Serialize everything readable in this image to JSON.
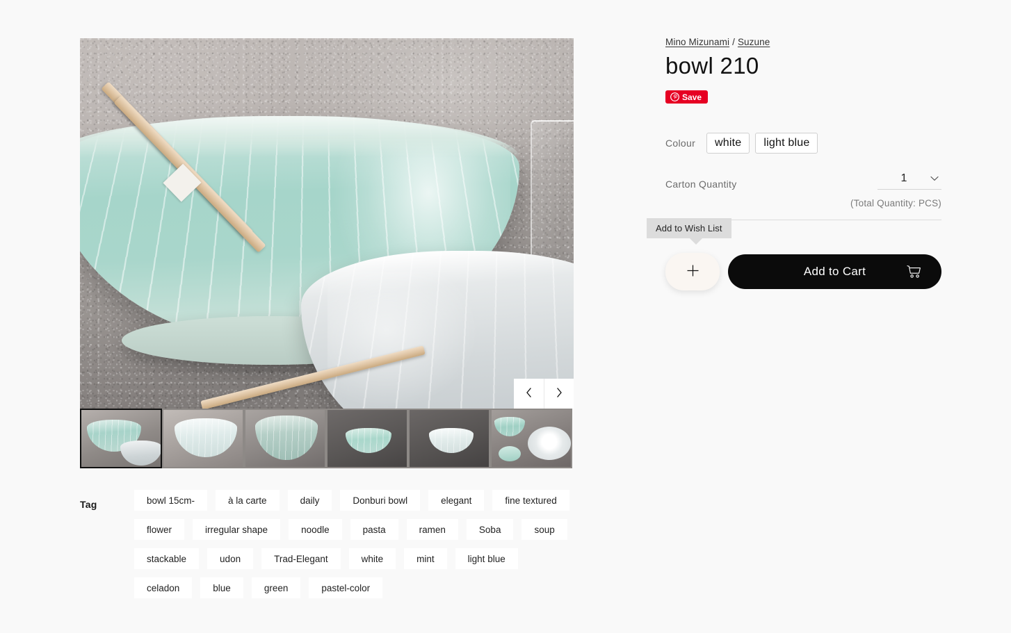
{
  "product": {
    "breadcrumb": {
      "brand": "Mino Mizunami",
      "separator": "/",
      "series": "Suzune"
    },
    "title": "bowl 210",
    "pin_save_label": "Save"
  },
  "options": {
    "colour_label": "Colour",
    "colours": [
      {
        "label": "white"
      },
      {
        "label": "light blue"
      }
    ],
    "carton_quantity_label": "Carton Quantity",
    "carton_quantity_value": "1",
    "carton_quantity_options": [
      "1"
    ],
    "total_quantity_note": "(Total Quantity: PCS)"
  },
  "actions": {
    "wishlist_tooltip": "Add to Wish List",
    "wishlist_icon": "plus-icon",
    "add_to_cart_label": "Add to Cart",
    "cart_icon": "shopping-cart-icon"
  },
  "gallery": {
    "prev_icon": "chevron-left-icon",
    "next_icon": "chevron-right-icon",
    "thumbnails": [
      {
        "alt": "celadon fluted bowl with chopsticks",
        "selected": true
      },
      {
        "alt": "white fluted bowl angled view",
        "selected": false
      },
      {
        "alt": "celadon bowl side view",
        "selected": false
      },
      {
        "alt": "celadon bowl on dark background",
        "selected": false
      },
      {
        "alt": "white bowl on dark background",
        "selected": false
      },
      {
        "alt": "bowls and plates set",
        "selected": false
      }
    ]
  },
  "tags": {
    "label": "Tag",
    "items": [
      "bowl 15cm-",
      "à la carte",
      "daily",
      "Donburi bowl",
      "elegant",
      "fine textured",
      "flower",
      "irregular shape",
      "noodle",
      "pasta",
      "ramen",
      "Soba",
      "soup",
      "stackable",
      "udon",
      "Trad-Elegant",
      "white",
      "mint",
      "light blue",
      "celadon",
      "blue",
      "green",
      "pastel-color"
    ]
  },
  "colors": {
    "page_background": "#f9f9f9",
    "accent_pinterest": "#e60023",
    "cart_button": "#0b0b0b",
    "tooltip_background": "#dcdcdc",
    "wishlist_button": "#faf6f2",
    "tag_background": "#ffffff"
  }
}
